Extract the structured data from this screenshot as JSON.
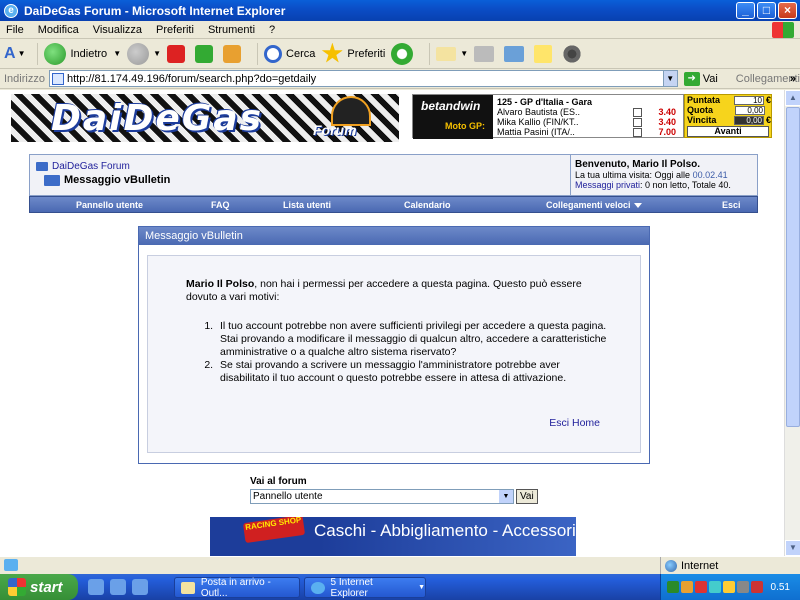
{
  "window": {
    "title": "DaiDeGas Forum - Microsoft Internet Explorer",
    "controls": {
      "minimize": "_",
      "maximize": "□",
      "close": "×"
    }
  },
  "menu": [
    "File",
    "Modifica",
    "Visualizza",
    "Preferiti",
    "Strumenti",
    "?"
  ],
  "toolbar": {
    "back": "Indietro",
    "search": "Cerca",
    "favorites": "Preferiti"
  },
  "address": {
    "label": "Indirizzo",
    "url": "http://81.174.49.196/forum/search.php?do=getdaily",
    "go": "Vai",
    "links": "Collegamenti"
  },
  "banner": {
    "logo": "DaiDeGas",
    "logo_sub": "Forum",
    "bet_brand": "betandwin",
    "bet_sub": "Moto GP:",
    "race": "125 - GP d'Italia - Gara",
    "riders": [
      {
        "name": "Alvaro Bautista (ES..",
        "odds": "3.40"
      },
      {
        "name": "Mika Kallio (FIN/KT..",
        "odds": "3.40"
      },
      {
        "name": "Mattia Pasini (ITA/..",
        "odds": "7.00"
      }
    ],
    "stake": {
      "puntata_label": "Puntata",
      "puntata_value": "10",
      "quota_label": "Quota",
      "quota_value": "0,00",
      "vincita_label": "Vincita",
      "vincita_value": "0,00",
      "currency": "€",
      "avanti": "Avanti"
    }
  },
  "nav": {
    "forum_link": "DaiDeGas Forum",
    "current": "Messaggio vBulletin",
    "welcome": "Benvenuto, Mario Il Polso.",
    "last_visit_prefix": "La tua ultima visita: Oggi alle",
    "last_visit_time": "00.02.41",
    "pm_link": "Messaggi privati",
    "pm_status": ": 0 non letto, Totale 40.",
    "bar": [
      "Pannello utente",
      "FAQ",
      "Lista utenti",
      "Calendario",
      "Collegamenti veloci",
      "Esci"
    ]
  },
  "message": {
    "title": "Messaggio vBulletin",
    "user": "Mario Il Polso",
    "intro": ", non hai i permessi per accedere a questa pagina. Questo può essere dovuto a vari motivi:",
    "items": [
      "Il tuo account potrebbe non avere sufficienti privilegi per accedere a questa pagina. Stai provando a modificare il messaggio di qualcun altro, accedere a caratteristiche amministrative o a qualche altro sistema riservato?",
      "Se stai provando a scrivere un messaggio l'amministratore potrebbe aver disabilitato il tuo account o questo potrebbe essere in attesa di attivazione."
    ],
    "link_logout": "Esci",
    "link_home": "Home"
  },
  "jump": {
    "label": "Vai al forum",
    "selected": "Pannello utente",
    "button": "Vai"
  },
  "ad": {
    "shop": "RACING SHOP",
    "text": "Caschi - Abbigliamento - Accessori per Moto"
  },
  "status": {
    "zone": "Internet"
  },
  "taskbar": {
    "start": "start",
    "tasks": [
      "Posta in arrivo - Outl...",
      "5 Internet Explorer"
    ],
    "clock": "0.51"
  },
  "colors": {
    "accent": "#4a69b2",
    "link": "#22229c",
    "odds": "#cc0000",
    "stake_bg": "#f6d41c"
  }
}
